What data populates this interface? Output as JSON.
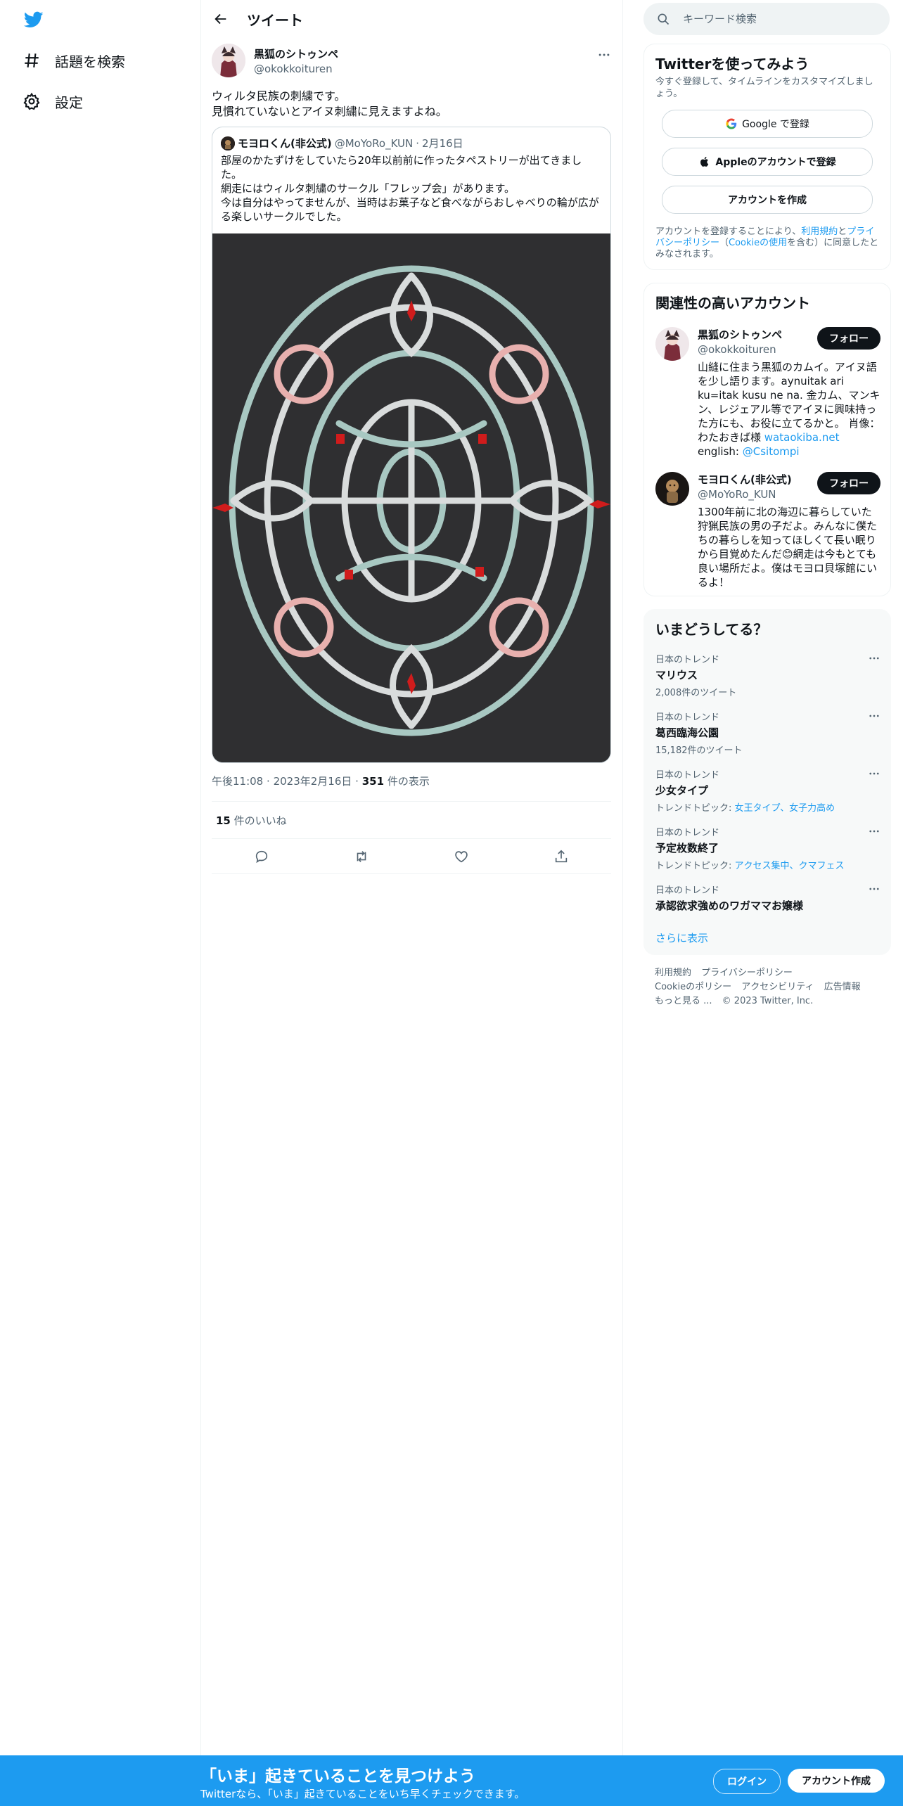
{
  "nav": {
    "explore_label": "話題を検索",
    "settings_label": "設定"
  },
  "header": {
    "title": "ツイート"
  },
  "tweet": {
    "author_name": "黒狐のシトゥンペ",
    "author_handle": "@okokkoituren",
    "text": "ウィルタ民族の刺繍です。\n見慣れていないとアイヌ刺繍に見えますよね。",
    "quote": {
      "author_name": "モヨロくん(非公式)",
      "author_handle": "@MoYoRo_KUN",
      "dot": "·",
      "date": "2月16日",
      "text": "部屋のかたずけをしていたら20年以前前に作ったタペストリーが出てきました。\n網走にはウィルタ刺繍のサークル「フレップ会」があります。\n今は自分はやってませんが、当時はお菓子など食べながらおしゃべりの輪が広がる楽しいサークルでした。"
    },
    "time": "午後11:08",
    "sep": "·",
    "date": "2023年2月16日",
    "views_count": "351",
    "views_label": " 件の表示",
    "likes_count": "15",
    "likes_label": " 件のいいね"
  },
  "search": {
    "placeholder": "キーワード検索"
  },
  "signup": {
    "title": "Twitterを使ってみよう",
    "subtitle": "今すぐ登録して、タイムラインをカスタマイズしましょう。",
    "google_label": "Google で登録",
    "apple_label": "Appleのアカウントで登録",
    "create_label": "アカウントを作成",
    "legal_prefix": "アカウントを登録することにより、",
    "terms_link": "利用規約",
    "and": "と",
    "privacy_link": "プライバシーポリシー",
    "cookie_open": "（",
    "cookie_link": "Cookieの使用",
    "legal_suffix": "を含む）に同意したとみなされます。"
  },
  "relevant": {
    "title": "関連性の高いアカウント",
    "follow_label": "フォロー",
    "accounts": [
      {
        "name": "黒狐のシトゥンペ",
        "handle": "@okokkoituren",
        "bio": "山縫に住まう黒狐のカムイ。アイヌ語を少し語ります。aynuitak ari ku=itak kusu ne na. 金カム、マンキン、レジェアル等でアイヌに興味持った方にも、お役に立てるかと。 肖像：わたおきば様 ",
        "bio_link": "wataokiba.net",
        "bio_mid": " english: ",
        "bio_link2": "@Csitompi"
      },
      {
        "name": "モヨロくん(非公式)",
        "handle": "@MoYoRo_KUN",
        "bio": "1300年前に北の海辺に暮らしていた狩猟民族の男の子だよ。みんなに僕たちの暮らしを知ってほしくて長い眠りから目覚めたんだ😊網走は今もとても良い場所だよ。僕はモヨロ貝塚館にいるよ！"
      }
    ]
  },
  "trends": {
    "title": "いまどうしてる？",
    "items": [
      {
        "category": "日本のトレンド",
        "name": "マリウス",
        "count": "2,008件のツイート"
      },
      {
        "category": "日本のトレンド",
        "name": "葛西臨海公園",
        "count": "15,182件のツイート"
      },
      {
        "category": "日本のトレンド",
        "name": "少女タイプ",
        "topic_prefix": "トレンドトピック: ",
        "topic_links": "女王タイプ、女子力高め"
      },
      {
        "category": "日本のトレンド",
        "name": "予定枚数終了",
        "topic_prefix": "トレンドトピック: ",
        "topic_links": "アクセス集中、クマフェス"
      },
      {
        "category": "日本のトレンド",
        "name": "承認欲求強めのワガママお嬢様"
      }
    ],
    "show_more": "さらに表示"
  },
  "footer": {
    "terms": "利用規約",
    "privacy": "プライバシーポリシー",
    "cookie": "Cookieのポリシー",
    "accessibility": "アクセシビリティ",
    "ads": "広告情報",
    "more": "もっと見る ...",
    "copyright": "© 2023 Twitter, Inc."
  },
  "bottom_bar": {
    "title": "「いま」起きていることを見つけよう",
    "subtitle": "Twitterなら、「いま」起きていることをいち早くチェックできます。",
    "login_label": "ログイン",
    "signup_label": "アカウント作成"
  },
  "colors": {
    "brand": "#1d9bf0",
    "text": "#0f1419",
    "secondary": "#536471",
    "border": "#eff3f4"
  }
}
